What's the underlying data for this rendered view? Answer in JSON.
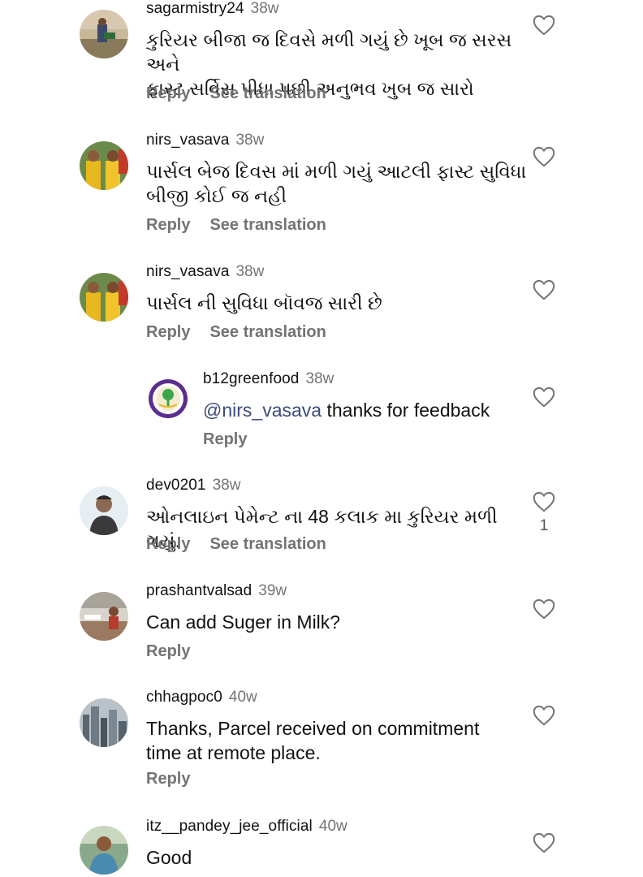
{
  "reply_label": "Reply",
  "translate_label": "See translation",
  "comments": [
    {
      "username": "sagarmistry24",
      "age": "38w",
      "text_lines": [
        "કુરિયર બીજા જ દિવસે મળી ગયું છે ખૂબ જ સરસ અને",
        "ફાસ્ટ સર્વિસ પીધા પછી અનુભવ ખુબ જ સારો"
      ]
    },
    {
      "username": "nirs_vasava",
      "age": "38w",
      "text_lines": [
        "પાર્સલ બેજ દિવસ માં મળી ગયું આટલી ફાસ્ટ સુવિધા",
        "બીજી કોઈ જ નહી"
      ]
    },
    {
      "username": "nirs_vasava",
      "age": "38w",
      "text_lines": [
        "પાર્સલ ની સુવિધા બૉવજ સારી છે"
      ]
    },
    {
      "username": "b12greenfood",
      "age": "38w",
      "mention": "@nirs_vasava",
      "text": "thanks for feedback"
    },
    {
      "username": "dev0201",
      "age": "38w",
      "text_lines": [
        "ઓનલાઇન પેમેન્ટ ના 48 કલાક મા કુરિયર મળી ગયું."
      ],
      "likes": "1"
    },
    {
      "username": "prashantvalsad",
      "age": "39w",
      "text_lines": [
        "Can add Suger in Milk?"
      ]
    },
    {
      "username": "chhagpoc0",
      "age": "40w",
      "text_lines": [
        "Thanks, Parcel received on commitment",
        "time at remote place."
      ]
    },
    {
      "username": "itz__pandey_jee_official",
      "age": "40w",
      "text_lines": [
        "Good"
      ]
    }
  ],
  "icons": {
    "like": "heart-icon"
  },
  "colors": {
    "muted": "#737373",
    "mention": "#3b4c7a",
    "brand_green": "#3aa64a",
    "brand_purple": "#5b2d8e"
  }
}
